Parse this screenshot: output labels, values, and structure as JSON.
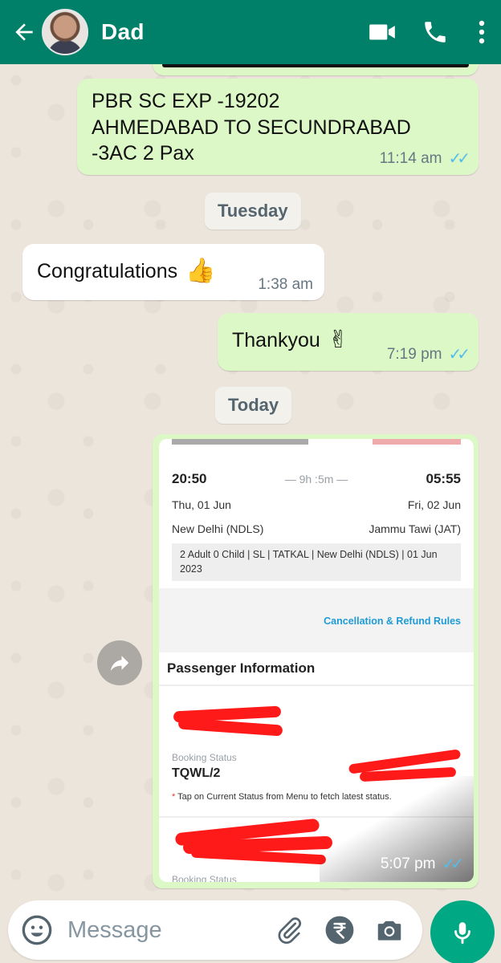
{
  "header": {
    "contact_name": "Dad",
    "colors": {
      "bar": "#008069"
    }
  },
  "messages": [
    {
      "direction": "out",
      "text_lines": [
        "PBR SC EXP -19202",
        "AHMEDABAD TO SECUNDRABAD",
        "-3AC 2 Pax"
      ],
      "time": "11:14 am",
      "read": true
    },
    {
      "type": "date",
      "label": "Tuesday"
    },
    {
      "direction": "in",
      "text": "Congratulations",
      "emoji": "thumbs-up",
      "time": "1:38 am"
    },
    {
      "direction": "out",
      "text": "Thankyou",
      "emoji": "victory-hand",
      "time": "7:19 pm",
      "read": true
    },
    {
      "type": "date",
      "label": "Today"
    },
    {
      "direction": "out",
      "type": "image",
      "time": "5:07 pm",
      "read": true
    }
  ],
  "ticket": {
    "depart_time": "20:50",
    "duration": "— 9h :5m —",
    "arrive_time": "05:55",
    "depart_date": "Thu, 01 Jun",
    "arrive_date": "Fri, 02 Jun",
    "from_station": "New Delhi (NDLS)",
    "to_station": "Jammu Tawi (JAT)",
    "details_line1": "2 Adult 0 Child  | SL | TATKAL | New Delhi (NDLS) | 01 Jun",
    "details_line2": "2023",
    "cancel_link": "Cancellation & Refund Rules",
    "section_title": "Passenger Information",
    "booking_status_label": "Booking Status",
    "booking_status_value": "TQWL/2",
    "note": "Tap on Current Status from Menu to fetch latest status.",
    "note_star": "*",
    "booking_status_label_2": "Booking Status"
  },
  "composer": {
    "placeholder": "Message"
  }
}
